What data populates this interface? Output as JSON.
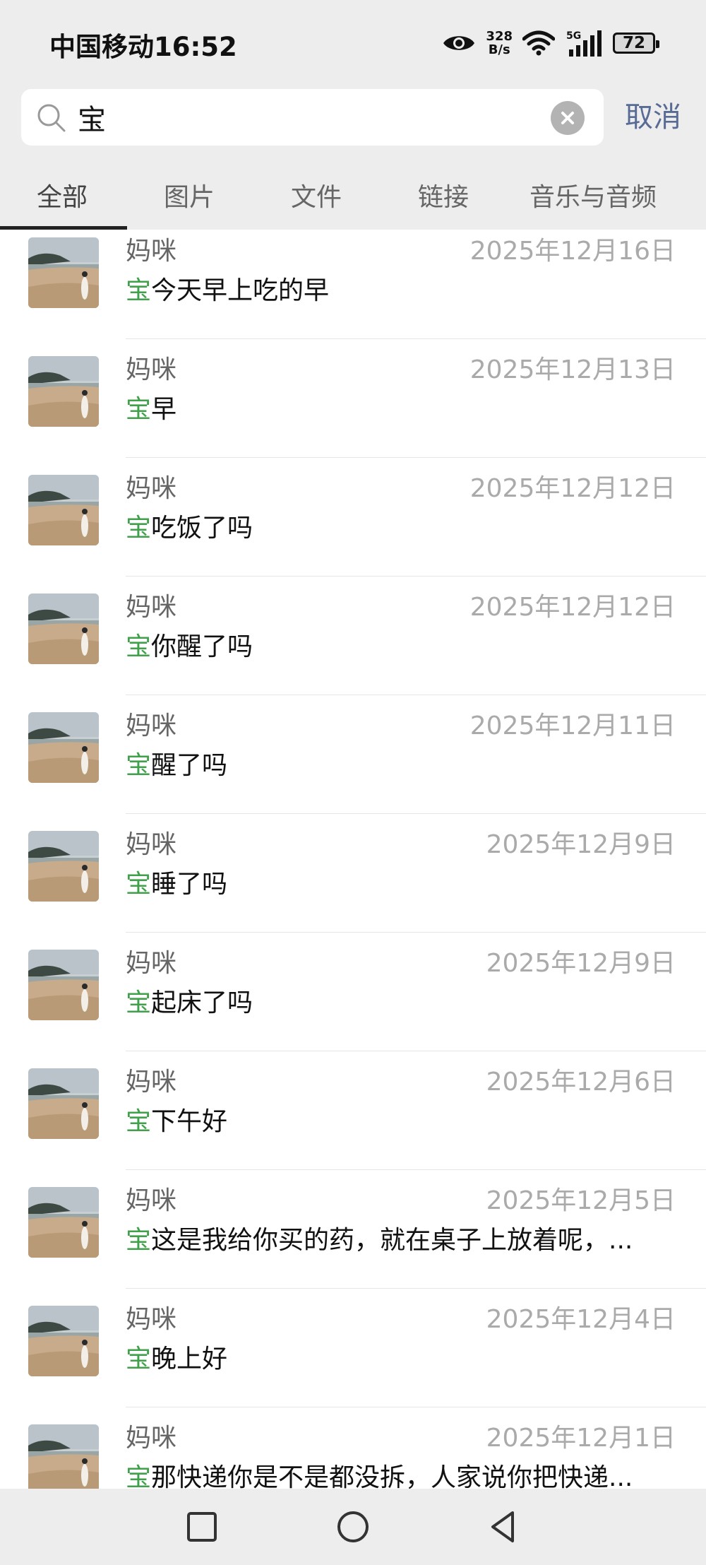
{
  "status": {
    "carrier_time": "中国移动16:52",
    "net_speed_value": "328",
    "net_speed_unit": "B/s",
    "network_type": "5G",
    "battery": "72",
    "icons": [
      "eye-icon",
      "wifi-icon",
      "signal-icon",
      "battery-icon"
    ]
  },
  "search": {
    "query": "宝",
    "cancel_label": "取消"
  },
  "tabs": [
    {
      "label": "全部",
      "active": true
    },
    {
      "label": "图片",
      "active": false
    },
    {
      "label": "文件",
      "active": false
    },
    {
      "label": "链接",
      "active": false
    },
    {
      "label": "音乐与音频",
      "active": false
    }
  ],
  "results": [
    {
      "name": "妈咪",
      "date": "2025年12月16日",
      "keyword": "宝",
      "rest": "今天早上吃的早"
    },
    {
      "name": "妈咪",
      "date": "2025年12月13日",
      "keyword": "宝",
      "rest": "早"
    },
    {
      "name": "妈咪",
      "date": "2025年12月12日",
      "keyword": "宝",
      "rest": "吃饭了吗"
    },
    {
      "name": "妈咪",
      "date": "2025年12月12日",
      "keyword": "宝",
      "rest": "你醒了吗"
    },
    {
      "name": "妈咪",
      "date": "2025年12月11日",
      "keyword": "宝",
      "rest": "醒了吗"
    },
    {
      "name": "妈咪",
      "date": "2025年12月9日",
      "keyword": "宝",
      "rest": "睡了吗"
    },
    {
      "name": "妈咪",
      "date": "2025年12月9日",
      "keyword": "宝",
      "rest": "起床了吗"
    },
    {
      "name": "妈咪",
      "date": "2025年12月6日",
      "keyword": "宝",
      "rest": "下午好"
    },
    {
      "name": "妈咪",
      "date": "2025年12月5日",
      "keyword": "宝",
      "rest": "这是我给你买的药，就在桌子上放着呢，..."
    },
    {
      "name": "妈咪",
      "date": "2025年12月4日",
      "keyword": "宝",
      "rest": "晚上好"
    },
    {
      "name": "妈咪",
      "date": "2025年12月1日",
      "keyword": "宝",
      "rest": "那快递你是不是都没拆，人家说你把快递..."
    }
  ],
  "colors": {
    "highlight": "#3fa24a",
    "cancel": "#576b95",
    "background": "#ededed"
  }
}
